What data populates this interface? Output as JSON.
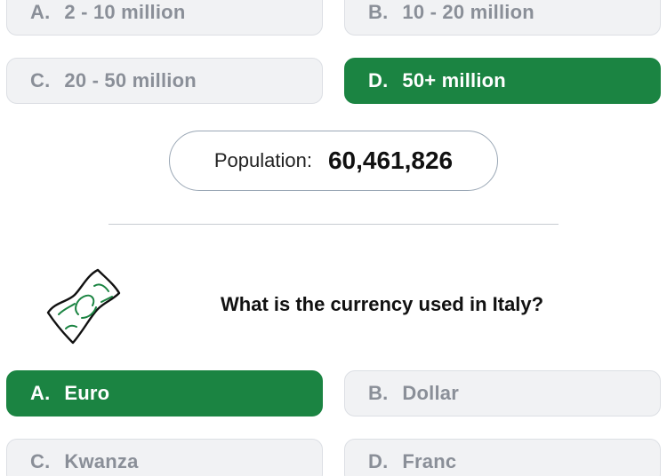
{
  "population_question": {
    "options": [
      {
        "letter": "A.",
        "label": "2 - 10 million",
        "state": "neutral"
      },
      {
        "letter": "B.",
        "label": "10 - 20 million",
        "state": "neutral"
      },
      {
        "letter": "C.",
        "label": "20 - 50 million",
        "state": "neutral"
      },
      {
        "letter": "D.",
        "label": "50+ million",
        "state": "correct"
      }
    ],
    "result_label": "Population:",
    "result_value": "60,461,826"
  },
  "currency_question": {
    "icon": "banknote-icon",
    "question": "What is the currency used in Italy?",
    "options": [
      {
        "letter": "A.",
        "label": "Euro",
        "state": "correct"
      },
      {
        "letter": "B.",
        "label": "Dollar",
        "state": "neutral"
      },
      {
        "letter": "C.",
        "label": "Kwanza",
        "state": "neutral"
      },
      {
        "letter": "D.",
        "label": "Franc",
        "state": "neutral"
      }
    ]
  },
  "colors": {
    "correct": "#1b8442",
    "neutral_bg": "#f1f2f4",
    "neutral_text": "#8a8f98"
  }
}
